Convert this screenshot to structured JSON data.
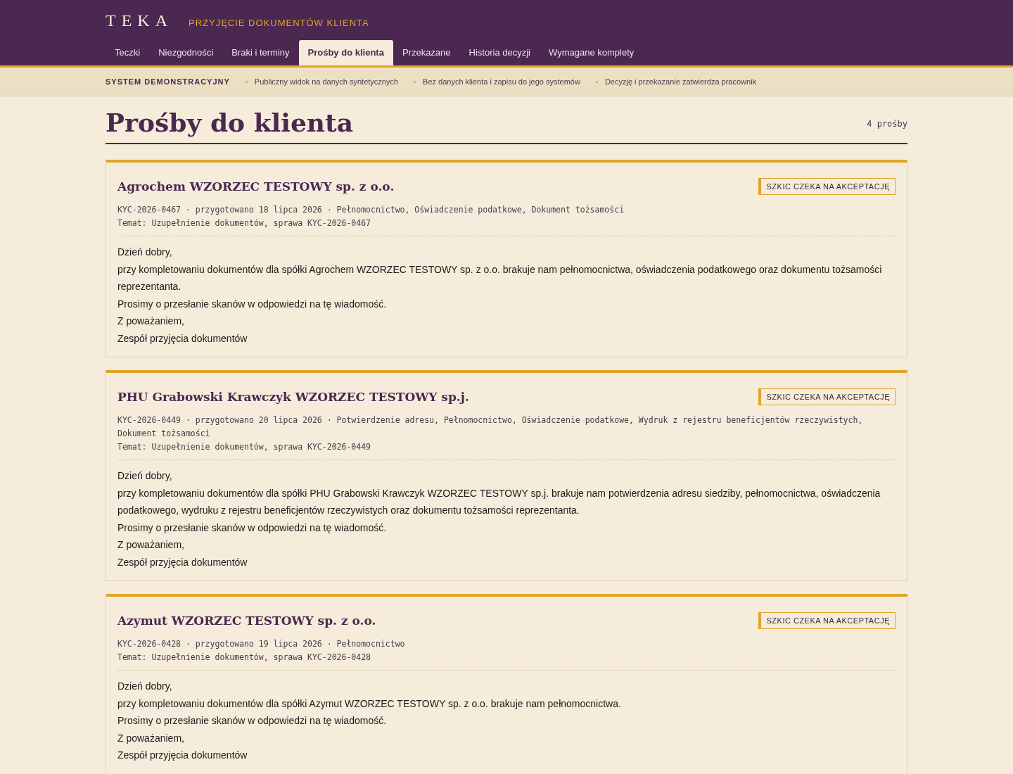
{
  "header": {
    "logo": "TEKA",
    "subtitle": "PRZYJĘCIE DOKUMENTÓW KLIENTA"
  },
  "tabs": [
    {
      "label": "Teczki",
      "selected": false
    },
    {
      "label": "Niezgodności",
      "selected": false
    },
    {
      "label": "Braki i terminy",
      "selected": false
    },
    {
      "label": "Prośby do klienta",
      "selected": true
    },
    {
      "label": "Przekazane",
      "selected": false
    },
    {
      "label": "Historia decyzji",
      "selected": false
    },
    {
      "label": "Wymagane komplety",
      "selected": false
    }
  ],
  "notice_bar": {
    "title": "SYSTEM DEMONSTRACYJNY",
    "items": [
      "Publiczny widok na danych syntetycznych",
      "Bez danych klienta i zapisu do jego systemów",
      "Decyzję i przekazanie zatwierdza pracownik"
    ]
  },
  "page": {
    "title": "Prośby do klienta",
    "count": "4 prośby"
  },
  "requests": [
    {
      "company": "Agrochem WZORZEC TESTOWY sp. z o.o.",
      "status": "SZKIC CZEKA NA AKCEPTACJĘ",
      "meta": "KYC-2026-0467 · przygotowano 18 lipca 2026 · Pełnomocnictwo, Oświadczenie podatkowe, Dokument tożsamości",
      "subject": "Temat: Uzupełnienie dokumentów, sprawa KYC-2026-0467",
      "body": [
        "Dzień dobry,",
        "przy kompletowaniu dokumentów dla spółki Agrochem WZORZEC TESTOWY sp. z o.o. brakuje nam pełnomocnictwa, oświadczenia podatkowego oraz dokumentu tożsamości reprezentanta.",
        "Prosimy o przesłanie skanów w odpowiedzi na tę wiadomość.",
        "Z poważaniem,",
        "Zespół przyjęcia dokumentów"
      ]
    },
    {
      "company": "PHU Grabowski Krawczyk WZORZEC TESTOWY sp.j.",
      "status": "SZKIC CZEKA NA AKCEPTACJĘ",
      "meta": "KYC-2026-0449 · przygotowano 20 lipca 2026 · Potwierdzenie adresu, Pełnomocnictwo, Oświadczenie podatkowe, Wydruk z rejestru beneficjentów rzeczywistych, Dokument tożsamości",
      "subject": "Temat: Uzupełnienie dokumentów, sprawa KYC-2026-0449",
      "body": [
        "Dzień dobry,",
        "przy kompletowaniu dokumentów dla spółki PHU Grabowski Krawczyk WZORZEC TESTOWY sp.j. brakuje nam potwierdzenia adresu siedziby, pełnomocnictwa, oświadczenia podatkowego, wydruku z rejestru beneficjentów rzeczywistych oraz dokumentu tożsamości reprezentanta.",
        "Prosimy o przesłanie skanów w odpowiedzi na tę wiadomość.",
        "Z poważaniem,",
        "Zespół przyjęcia dokumentów"
      ]
    },
    {
      "company": "Azymut WZORZEC TESTOWY sp. z o.o.",
      "status": "SZKIC CZEKA NA AKCEPTACJĘ",
      "meta": "KYC-2026-0428 · przygotowano 19 lipca 2026 · Pełnomocnictwo",
      "subject": "Temat: Uzupełnienie dokumentów, sprawa KYC-2026-0428",
      "body": [
        "Dzień dobry,",
        "przy kompletowaniu dokumentów dla spółki Azymut WZORZEC TESTOWY sp. z o.o. brakuje nam pełnomocnictwa.",
        "Prosimy o przesłanie skanów w odpowiedzi na tę wiadomość.",
        "Z poważaniem,",
        "Zespół przyjęcia dokumentów"
      ]
    }
  ]
}
